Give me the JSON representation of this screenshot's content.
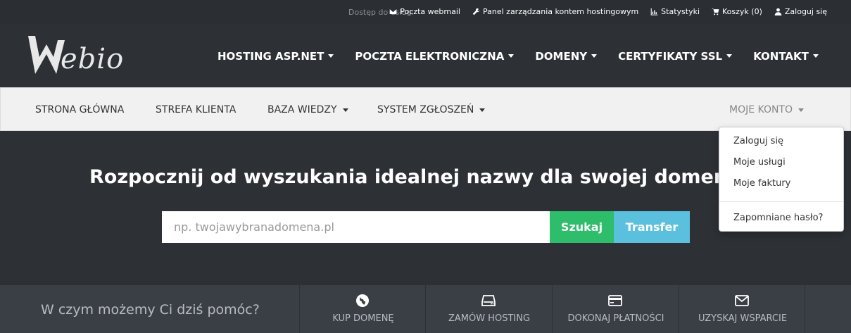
{
  "topbar": {
    "access_label": "Dostęp do usług:",
    "links": [
      {
        "icon": "envelope-icon",
        "label": "Poczta webmail"
      },
      {
        "icon": "wrench-icon",
        "label": "Panel zarządzania kontem hostingowym"
      },
      {
        "icon": "bar-chart-icon",
        "label": "Statystyki"
      },
      {
        "icon": "cart-icon",
        "label": "Koszyk (0)"
      },
      {
        "icon": "user-icon",
        "label": "Zaloguj się"
      }
    ]
  },
  "logo": {
    "text": "ebio"
  },
  "main_nav": [
    {
      "label": "HOSTING ASP.NET"
    },
    {
      "label": "POCZTA ELEKTRONICZNA"
    },
    {
      "label": "DOMENY"
    },
    {
      "label": "CERTYFIKATY SSL"
    },
    {
      "label": "KONTAKT"
    }
  ],
  "sub_nav": {
    "items": [
      {
        "label": "STRONA GŁÓWNA"
      },
      {
        "label": "STREFA KLIENTA"
      },
      {
        "label": "BAZA WIEDZY"
      },
      {
        "label": "SYSTEM ZGŁOSZEŃ"
      }
    ],
    "account": {
      "label": "MOJE KONTO"
    }
  },
  "account_dropdown": {
    "items": [
      {
        "label": "Zaloguj się"
      },
      {
        "label": "Moje usługi"
      },
      {
        "label": "Moje faktury"
      },
      {
        "label": "Zapomniane hasło?"
      }
    ]
  },
  "hero": {
    "title": "Rozpocznij od wyszukania idealnej nazwy dla swojej domeny",
    "search_placeholder": "np. twojawybranadomena.pl",
    "search_button": "Szukaj",
    "transfer_button": "Transfer"
  },
  "help_bar": {
    "question": "W czym możemy Ci dziś pomóc?",
    "actions": [
      {
        "icon": "globe-icon",
        "label": "KUP DOMENĘ"
      },
      {
        "icon": "server-icon",
        "label": "ZAMÓW HOSTING"
      },
      {
        "icon": "credit-card-icon",
        "label": "DOKONAJ PŁATNOŚCI"
      },
      {
        "icon": "envelope-icon",
        "label": "UZYSKAJ WSPARCIE"
      }
    ]
  },
  "colors": {
    "dark_bg": "#2d3035",
    "success": "#2ebd6b",
    "info": "#5bc0de",
    "help_bar": "#3a3e45"
  }
}
